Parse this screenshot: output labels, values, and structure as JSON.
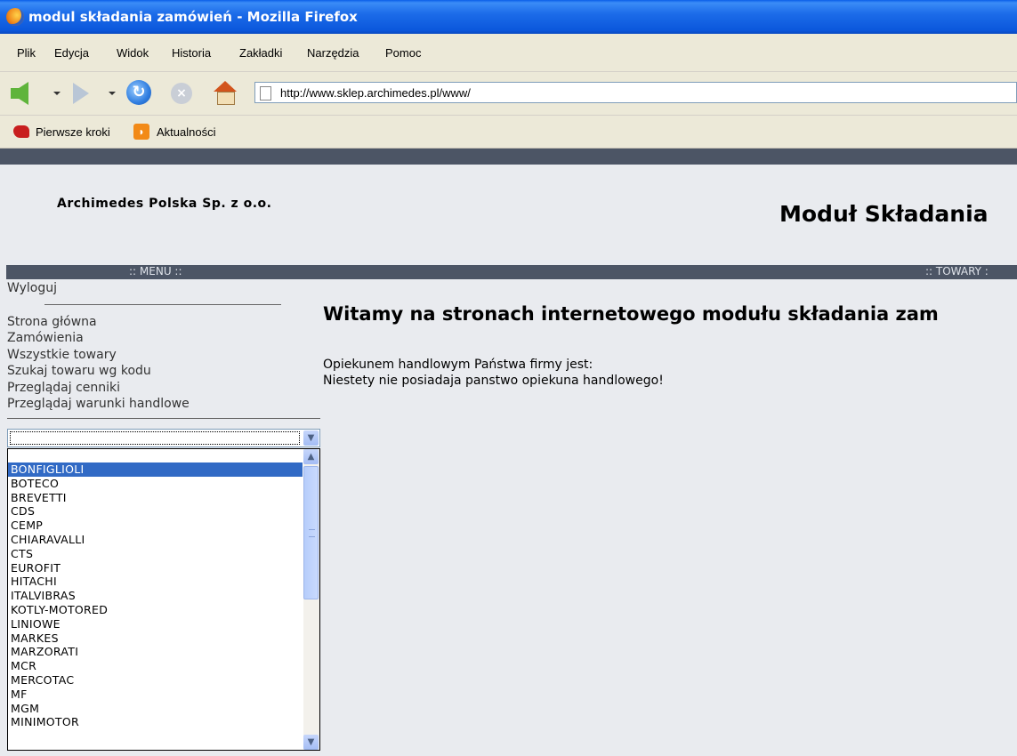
{
  "window": {
    "title": "modul składania zamówień - Mozilla Firefox"
  },
  "menubar": [
    "Plik",
    "Edycja",
    "Widok",
    "Historia",
    "Zakładki",
    "Narzędzia",
    "Pomoc"
  ],
  "address": {
    "url": "http://www.sklep.archimedes.pl/www/"
  },
  "bookmarks": {
    "first": "Pierwsze kroki",
    "second": "Aktualności"
  },
  "icons": {
    "back": "back-arrow",
    "forward": "forward-arrow",
    "reload": "reload",
    "stop": "stop",
    "home": "home",
    "page": "page",
    "firefox": "firefox-logo",
    "rss": "rss-feed"
  },
  "page": {
    "company": "Archimedes Polska Sp. z o.o.",
    "module_title": "Moduł Składania",
    "menu_label": ":: MENU ::",
    "towary_label": ":: TOWARY :",
    "logout": "Wyloguj",
    "nav": [
      "Strona główna",
      "Zamówienia",
      "Wszystkie towary",
      "Szukaj towaru wg kodu",
      "Przeglądaj cenniki",
      "Przeglądaj warunki handlowe"
    ],
    "welcome": "Witamy na stronach internetowego modułu składania zam",
    "info_line1": "Opiekunem handlowym Państwa firmy jest:",
    "info_line2": "Niestety nie posiadaja panstwo opiekuna handlowego!"
  },
  "producer_select": {
    "value": "",
    "options": [
      "BONFIGLIOLI",
      "BOTECO",
      "BREVETTI",
      "CDS",
      "CEMP",
      "CHIARAVALLI",
      "CTS",
      "EUROFIT",
      "HITACHI",
      "ITALVIBRAS",
      "KOTLY-MOTORED",
      "LINIOWE",
      "MARKES",
      "MARZORATI",
      "MCR",
      "MERCOTAC",
      "MF",
      "MGM",
      "MINIMOTOR"
    ],
    "highlighted": "BONFIGLIOLI"
  },
  "colors": {
    "titlebar": "#0b57dc",
    "chrome": "#ece9d8",
    "page_bg": "#e9ebef",
    "strip": "#4c5565",
    "selection": "#316ac5"
  }
}
